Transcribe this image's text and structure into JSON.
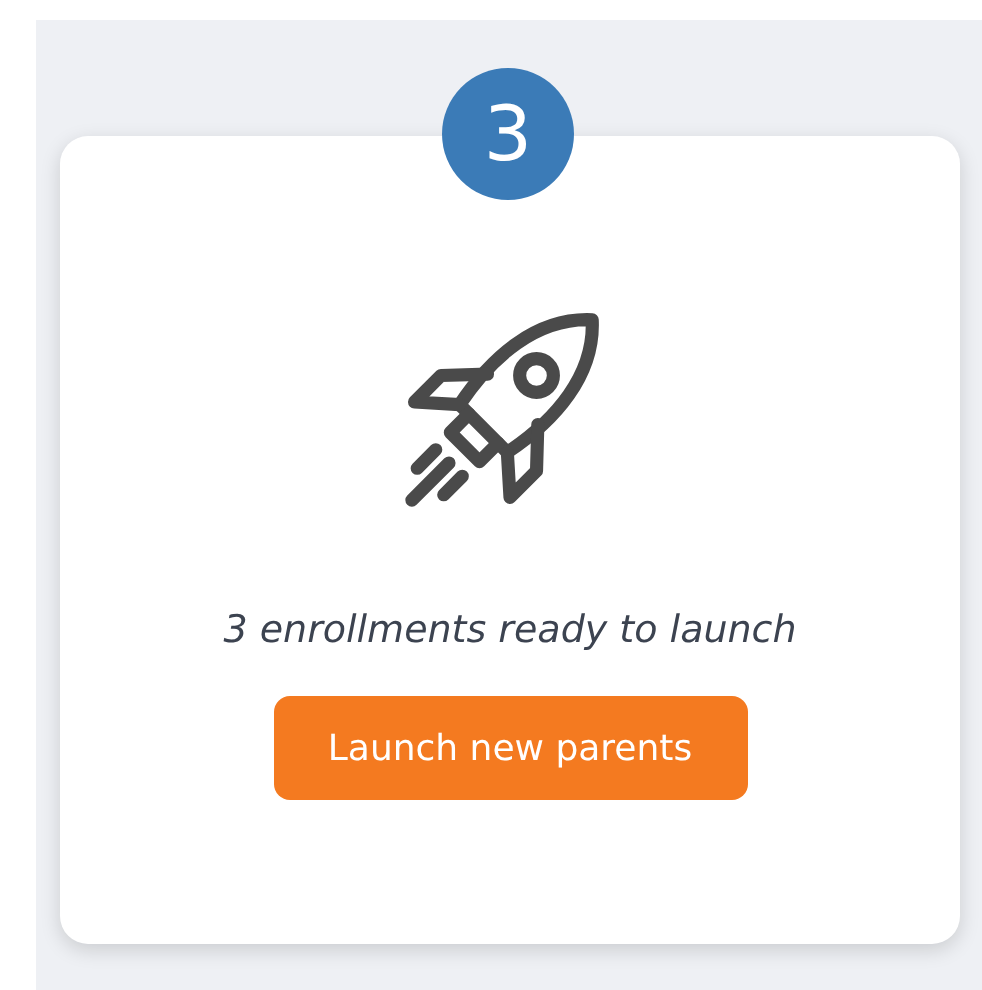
{
  "step_badge": "3",
  "card": {
    "message": "3 enrollments ready to launch",
    "button": "Launch new parents"
  }
}
